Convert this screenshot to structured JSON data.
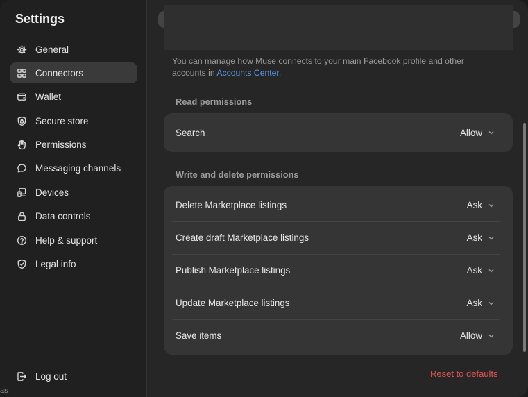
{
  "sidebar": {
    "title": "Settings",
    "items": [
      {
        "label": "General",
        "icon": "gear-icon"
      },
      {
        "label": "Connectors",
        "icon": "grid-icon",
        "active": true
      },
      {
        "label": "Wallet",
        "icon": "wallet-icon"
      },
      {
        "label": "Secure store",
        "icon": "shield-lock-icon"
      },
      {
        "label": "Permissions",
        "icon": "hand-icon"
      },
      {
        "label": "Messaging channels",
        "icon": "chat-bubble-icon"
      },
      {
        "label": "Devices",
        "icon": "devices-icon"
      },
      {
        "label": "Data controls",
        "icon": "lock-icon"
      },
      {
        "label": "Help & support",
        "icon": "help-icon"
      },
      {
        "label": "Legal info",
        "icon": "shield-check-icon"
      }
    ],
    "logout": {
      "label": "Log out",
      "icon": "logout-icon"
    }
  },
  "main": {
    "description": {
      "text": "You can manage how Muse connects to your main Facebook profile and other accounts in ",
      "link": "Accounts Center",
      "suffix": "."
    },
    "read_section": {
      "title": "Read permissions",
      "rows": [
        {
          "label": "Search",
          "value": "Allow"
        }
      ]
    },
    "write_section": {
      "title": "Write and delete permissions",
      "rows": [
        {
          "label": "Delete Marketplace listings",
          "value": "Ask"
        },
        {
          "label": "Create draft Marketplace listings",
          "value": "Ask"
        },
        {
          "label": "Publish Marketplace listings",
          "value": "Ask"
        },
        {
          "label": "Update Marketplace listings",
          "value": "Ask"
        },
        {
          "label": "Save items",
          "value": "Allow"
        }
      ]
    },
    "reset_label": "Reset to defaults"
  },
  "edge_text": "as",
  "colors": {
    "accent_link": "#5b95e6",
    "danger": "#e05454",
    "background": "#262626"
  }
}
